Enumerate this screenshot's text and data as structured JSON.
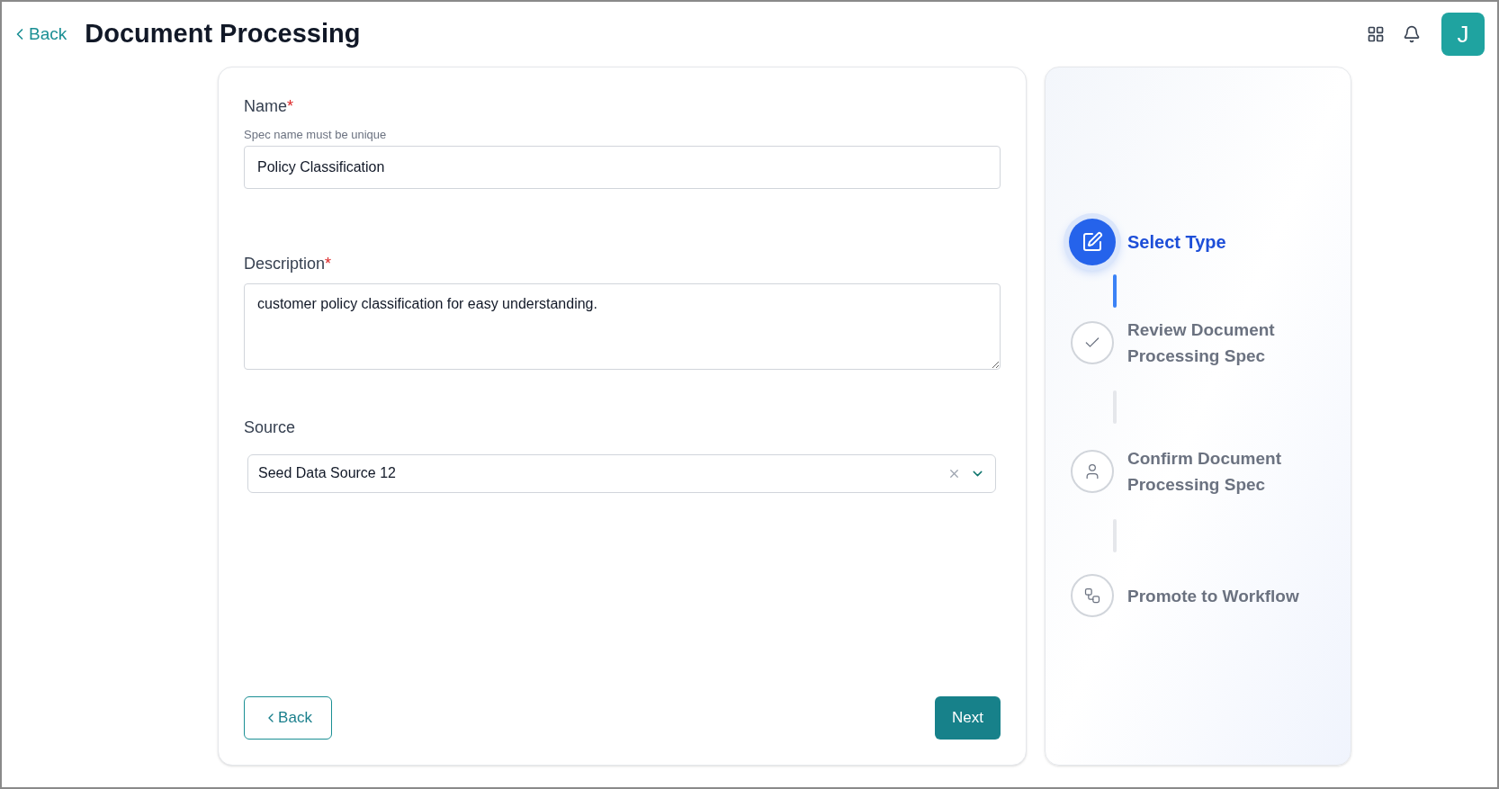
{
  "header": {
    "back_label": "Back",
    "title": "Document Processing",
    "avatar_initial": "J"
  },
  "form": {
    "fields": [
      {
        "kind": "input",
        "label": "Name",
        "required_mark": "*",
        "hint": "Spec name must be unique",
        "value": "Policy Classification"
      },
      {
        "kind": "textarea",
        "label": "Description",
        "required_mark": "*",
        "value": "customer policy classification for easy understanding."
      },
      {
        "kind": "select",
        "label": "Source",
        "value": "Seed Data Source 12"
      }
    ],
    "back_button": "Back",
    "next_button": "Next"
  },
  "steps": [
    {
      "label": "Select Type",
      "selected": true
    },
    {
      "label": "Review Document Processing Spec",
      "selected": false
    },
    {
      "label": "Confirm Document Processing Spec",
      "selected": false
    },
    {
      "label": "Promote to Workflow",
      "selected": false
    }
  ]
}
